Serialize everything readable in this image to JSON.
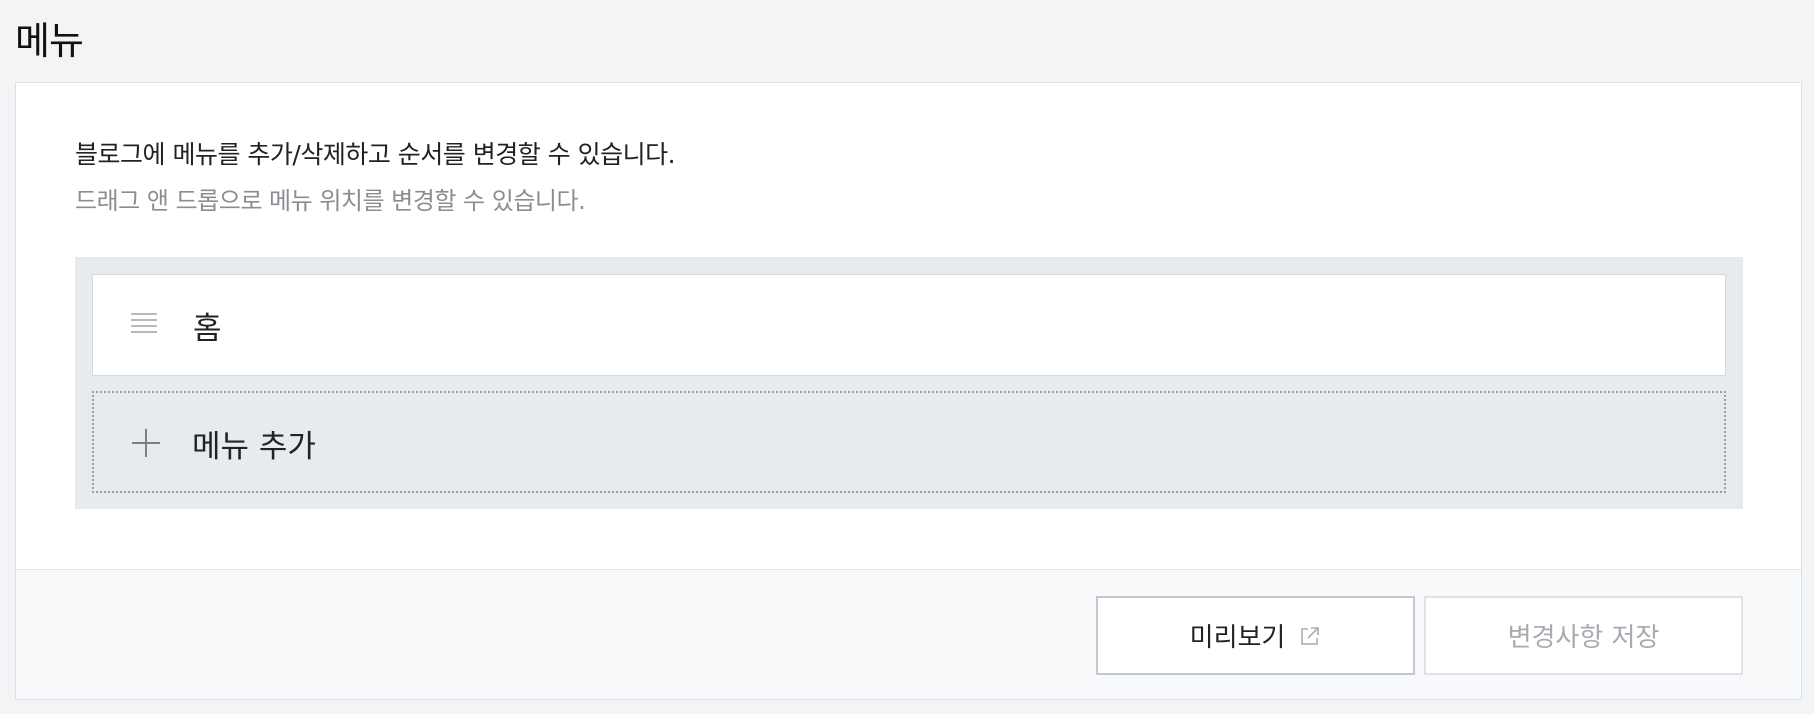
{
  "page": {
    "title": "메뉴"
  },
  "panel": {
    "description": "블로그에 메뉴를 추가/삭제하고 순서를 변경할 수 있습니다.",
    "subdescription": "드래그 앤 드롭으로 메뉴 위치를 변경할 수 있습니다."
  },
  "menu": {
    "items": [
      {
        "label": "홈",
        "icon": "drag-handle-icon"
      }
    ],
    "add_label": "메뉴 추가",
    "add_icon": "plus-icon"
  },
  "footer": {
    "preview_label": "미리보기",
    "preview_icon": "external-link-icon",
    "save_label": "변경사항 저장"
  }
}
